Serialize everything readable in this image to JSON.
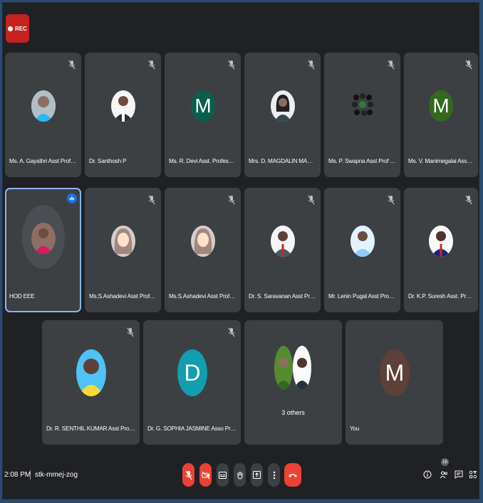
{
  "recording": {
    "label": "REC"
  },
  "participants": [
    {
      "name": "Ms. A. Gayathri Asst Prof EEE"
    },
    {
      "name": "Dr. Santhosh P"
    },
    {
      "name": "Ms. R. Devi Asst. Professor EEE",
      "initial": "M",
      "color": "#0b5e4d"
    },
    {
      "name": "Mrs. D. MAGDALIN MARY Asst ..."
    },
    {
      "name": "Ms. P. Swapna Asst Prof EEE"
    },
    {
      "name": "Ms. V. Manimegalai Asst Prof E...",
      "initial": "M",
      "color": "#33691e"
    },
    {
      "name": "HOD EEE"
    },
    {
      "name": "Ms.S.Ashadevi Asst Prof EEE"
    },
    {
      "name": "Ms.S.Ashadevi Asst Prof EEE"
    },
    {
      "name": "Dr. S. Saravanan Asst Prof EEE"
    },
    {
      "name": "Mr. Lenin Pugal Asst Prof EEE"
    },
    {
      "name": "Dr. K.P. Suresh Asst. Prof. EEE"
    },
    {
      "name": "Dr. R. SENTHIL KUMAR Asst Prof EEE"
    },
    {
      "name": "Dr. G. SOPHIA JASMINE Asso Prof EEE",
      "initial": "D",
      "color": "#129eaf"
    },
    {
      "name": "You",
      "initial": "M",
      "color": "#5d4037"
    }
  ],
  "others": {
    "label": "3 others"
  },
  "footer": {
    "time": "2:08 PM",
    "meeting_code": "stk-mmej-zog",
    "participant_count": "18"
  },
  "colors": {
    "background": "#202124",
    "tile": "#3c4043",
    "accent_red": "#ea4335",
    "active_border": "#8ab4f8"
  }
}
